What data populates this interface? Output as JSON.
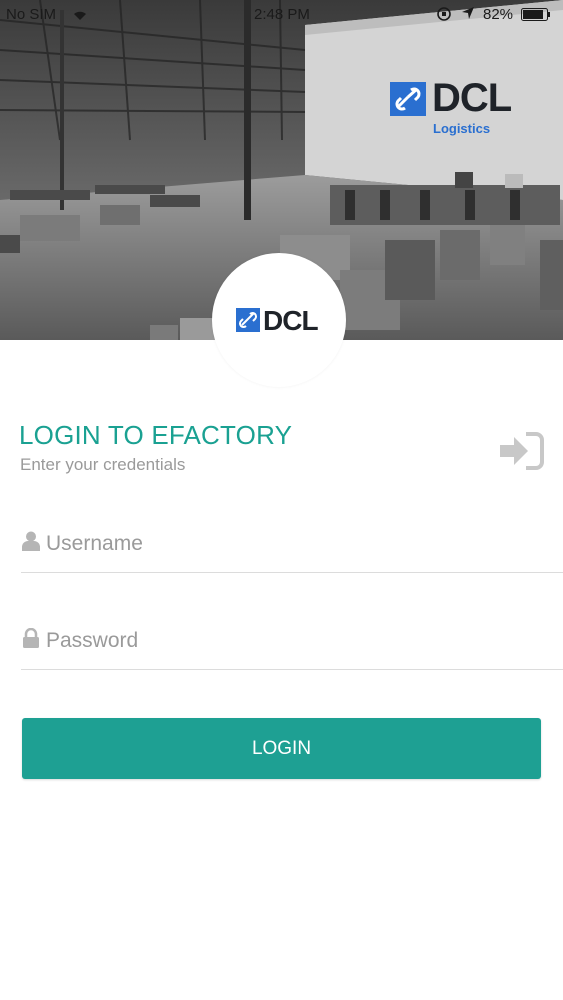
{
  "status_bar": {
    "carrier": "No SIM",
    "time": "2:48 PM",
    "battery_percent": "82%",
    "icons": [
      "wifi-icon",
      "orientation-lock-icon",
      "location-arrow-icon",
      "battery-icon"
    ]
  },
  "hero": {
    "image_description": "warehouse",
    "sign_logo_text": "DCL",
    "sign_logo_subtext": "Logistics"
  },
  "badge": {
    "logo_text": "DCL"
  },
  "login": {
    "title": "LOGIN TO EFACTORY",
    "subtitle": "Enter your credentials",
    "signin_icon": "sign-in-icon",
    "username_placeholder": "Username",
    "username_icon": "user-icon",
    "password_placeholder": "Password",
    "password_icon": "lock-icon",
    "button_label": "LOGIN"
  },
  "colors": {
    "accent": "#1aa192",
    "button": "#1ea093",
    "brand_blue": "#2a6fd0"
  }
}
